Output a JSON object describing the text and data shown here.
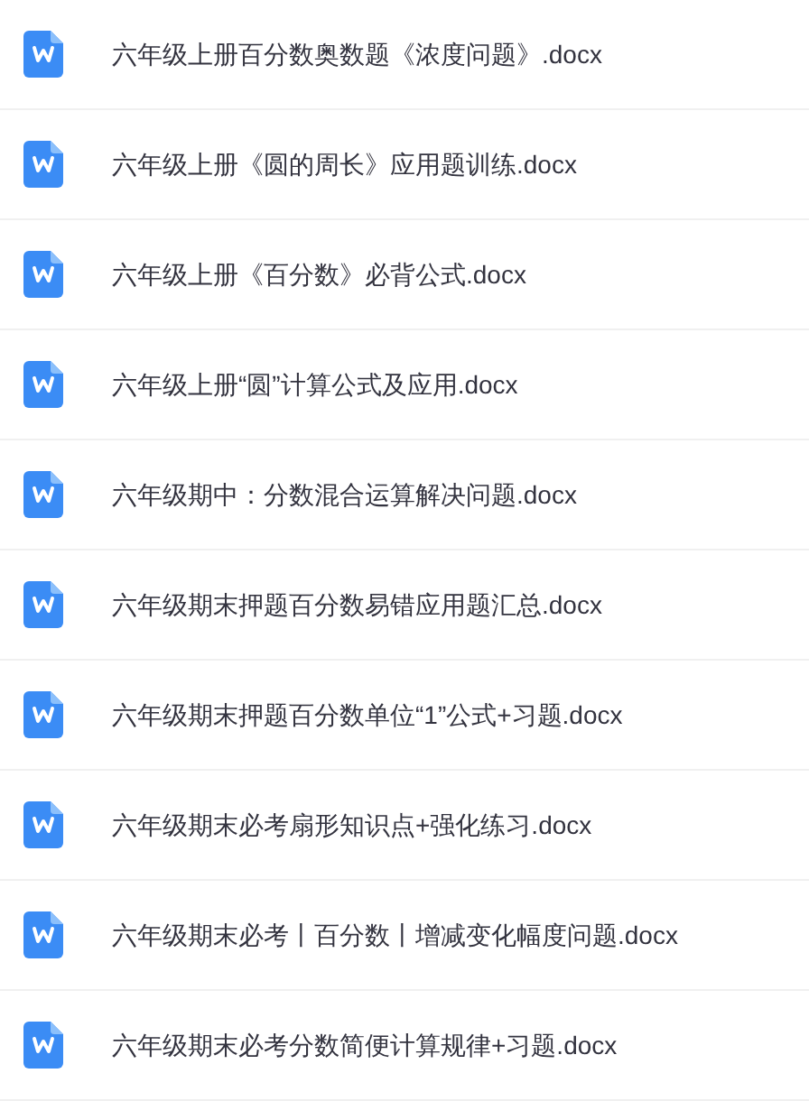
{
  "files": [
    {
      "name": "六年级上册百分数奥数题《浓度问题》.docx",
      "kind": "word"
    },
    {
      "name": "六年级上册《圆的周长》应用题训练.docx",
      "kind": "word"
    },
    {
      "name": "六年级上册《百分数》必背公式.docx",
      "kind": "word"
    },
    {
      "name": "六年级上册“圆”计算公式及应用.docx",
      "kind": "word"
    },
    {
      "name": "六年级期中：分数混合运算解决问题.docx",
      "kind": "word"
    },
    {
      "name": "六年级期末押题百分数易错应用题汇总.docx",
      "kind": "word"
    },
    {
      "name": "六年级期末押题百分数单位“1”公式+习题.docx",
      "kind": "word"
    },
    {
      "name": "六年级期末必考扇形知识点+强化练习.docx",
      "kind": "word"
    },
    {
      "name": "六年级期末必考丨百分数丨增减变化幅度问题.docx",
      "kind": "word"
    },
    {
      "name": "六年级期末必考分数简便计算规律+习题.docx",
      "kind": "word"
    }
  ]
}
